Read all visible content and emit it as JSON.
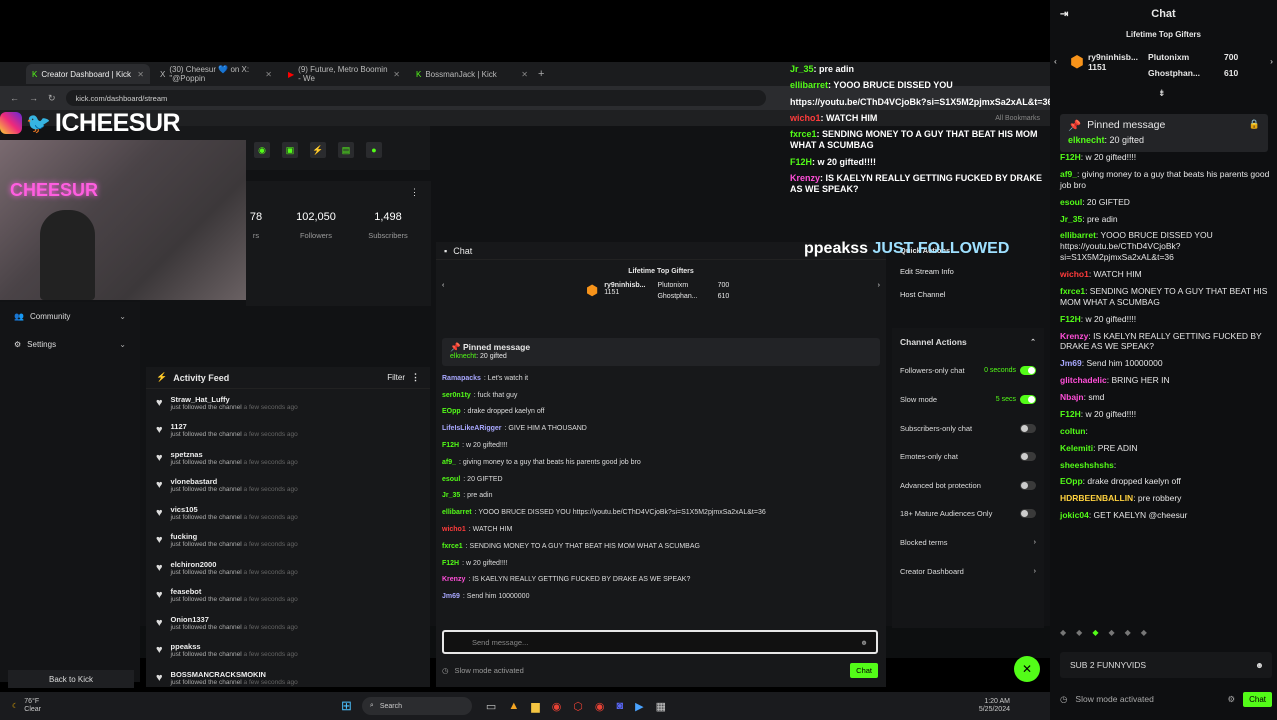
{
  "browser": {
    "tabs": [
      {
        "label": "Creator Dashboard | Kick",
        "active": true
      },
      {
        "label": "(30) Cheesur 💙 on X: \"@Poppin",
        "active": false
      },
      {
        "label": "(9) Future, Metro Boomin - We",
        "active": false
      },
      {
        "label": "BossmanJack | Kick",
        "active": false
      }
    ],
    "url": "kick.com/dashboard/stream",
    "all_bookmarks": "All Bookmarks"
  },
  "overlay": {
    "handle": "ICHEESUR",
    "followed_name": "ppeakss",
    "followed_text": "JUST FOLLOWED",
    "chat": [
      {
        "user": "Jr_35",
        "text": ": pre adin",
        "color": "#53fc18"
      },
      {
        "user": "ellibarret",
        "text": ": YOOO BRUCE DISSED YOU",
        "color": "#53fc18"
      },
      {
        "user": "",
        "text": "https://youtu.be/CThD4VCjoBk?si=S1X5M2pjmxSa2xAL&t=36",
        "color": "#fff"
      },
      {
        "user": "wicho1",
        "text": ": WATCH HIM",
        "color": "#ff3b3b"
      },
      {
        "user": "fxrce1",
        "text": ": SENDING MONEY TO A GUY THAT BEAT HIS MOM WHAT A SCUMBAG",
        "color": "#53fc18"
      },
      {
        "user": "F12H",
        "text": ": w 20 gifted!!!!",
        "color": "#53fc18"
      },
      {
        "user": "Krenzy",
        "text": ": IS KAELYN REALLY GETTING FUCKED BY DRAKE AS WE SPEAK?",
        "color": "#ff4fd8"
      }
    ]
  },
  "dashboard": {
    "stats": [
      {
        "value": "78",
        "label": "rs"
      },
      {
        "value": "102,050",
        "label": "Followers"
      },
      {
        "value": "1,498",
        "label": "Subscribers"
      }
    ],
    "nav": [
      {
        "label": "Community"
      },
      {
        "label": "Settings"
      }
    ],
    "back": "Back to Kick",
    "activity": {
      "title": "Activity Feed",
      "filter": "Filter",
      "sub": "just followed the channel",
      "time": "a few seconds ago",
      "items": [
        "Straw_Hat_Luffy",
        "1127",
        "spetznas",
        "vlonebastard",
        "vics105",
        "fucking",
        "elchiron2000",
        "feasebot",
        "Onion1337",
        "ppeakss",
        "BOSSMANCRACKSMOKIN"
      ]
    }
  },
  "mid_chat": {
    "title": "Chat",
    "gifters_title": "Lifetime Top Gifters",
    "gifters": [
      {
        "name": "ry9ninhisb...",
        "value": "1151"
      },
      {
        "name": "Plutonixm",
        "value": "700"
      },
      {
        "name": "Ghostphan...",
        "value": "610"
      }
    ],
    "pinned_title": "Pinned message",
    "pinned_user": "elknecht",
    "pinned_text": ": 20 gifted",
    "messages": [
      {
        "user": "Ramapacks",
        "text": ": Let's watch it",
        "color": "#a8a8ff"
      },
      {
        "user": "ser0n1ty",
        "text": ": fuck that guy",
        "color": "#53fc18"
      },
      {
        "user": "EOpp",
        "text": ": drake dropped kaelyn off",
        "color": "#53fc18"
      },
      {
        "user": "LifeIsLikeARigger",
        "text": ": GIVE HIM A THOUSAND",
        "color": "#a8a8ff"
      },
      {
        "user": "F12H",
        "text": ": w 20 gifted!!!!",
        "color": "#53fc18"
      },
      {
        "user": "af9_",
        "text": ": giving money to a guy that beats his parents good job bro",
        "color": "#53fc18"
      },
      {
        "user": "esoul",
        "text": ": 20 GIFTED",
        "color": "#53fc18"
      },
      {
        "user": "Jr_35",
        "text": ": pre adin",
        "color": "#53fc18"
      },
      {
        "user": "ellibarret",
        "text": ": YOOO BRUCE DISSED YOU https://youtu.be/CThD4VCjoBk?si=S1X5M2pjmxSa2xAL&t=36",
        "color": "#53fc18"
      },
      {
        "user": "wicho1",
        "text": ": WATCH HIM",
        "color": "#ff3b3b"
      },
      {
        "user": "fxrce1",
        "text": ": SENDING MONEY TO A GUY THAT BEAT HIS MOM WHAT A SCUMBAG",
        "color": "#53fc18"
      },
      {
        "user": "F12H",
        "text": ": w 20 gifted!!!!",
        "color": "#53fc18"
      },
      {
        "user": "Krenzy",
        "text": ": IS KAELYN REALLY GETTING FUCKED BY DRAKE AS WE SPEAK?",
        "color": "#ff4fd8"
      },
      {
        "user": "Jm69",
        "text": ": Send him 10000000",
        "color": "#a8a8ff"
      }
    ],
    "placeholder": "Send message...",
    "slow": "Slow mode activated",
    "chat_btn": "Chat"
  },
  "actions": {
    "quick": "Quick Actions",
    "edit": "Edit Stream Info",
    "host": "Host Channel",
    "title": "Channel Actions",
    "rows": [
      {
        "label": "Followers-only chat",
        "value": "0 seconds",
        "on": true
      },
      {
        "label": "Slow mode",
        "value": "5 secs",
        "on": true
      },
      {
        "label": "Subscribers-only chat",
        "value": "",
        "on": false
      },
      {
        "label": "Emotes-only chat",
        "value": "",
        "on": false
      },
      {
        "label": "Advanced bot protection",
        "value": "",
        "on": false
      },
      {
        "label": "18+ Mature Audiences Only",
        "value": "",
        "on": false
      },
      {
        "label": "Blocked terms",
        "value": "",
        "on": null
      },
      {
        "label": "Creator Dashboard",
        "value": "",
        "on": null
      }
    ]
  },
  "taskbar": {
    "temp": "76°F",
    "weather": "Clear",
    "search": "Search",
    "time": "1:20 AM",
    "date": "5/25/2024"
  },
  "rside": {
    "title": "Chat",
    "gifters_title": "Lifetime Top Gifters",
    "gifters": [
      {
        "name": "ry9ninhisb...",
        "value": "1151"
      },
      {
        "name": "Plutonixm",
        "value": "700"
      },
      {
        "name": "Ghostphan...",
        "value": "610"
      }
    ],
    "pinned_title": "Pinned message",
    "pinned_user": "elknecht",
    "pinned_text": ": 20 gifted",
    "messages": [
      {
        "user": "F12H",
        "text": ": w 20 gifted!!!!",
        "color": "#53fc18"
      },
      {
        "user": "af9_",
        "text": ": giving money to a guy that beats his parents good job bro",
        "color": "#53fc18"
      },
      {
        "user": "esoul",
        "text": ": 20 GIFTED",
        "color": "#53fc18"
      },
      {
        "user": "Jr_35",
        "text": ": pre adin",
        "color": "#53fc18"
      },
      {
        "user": "ellibarret",
        "text": ": YOOO BRUCE DISSED YOU https://youtu.be/CThD4VCjoBk?si=S1X5M2pjmxSa2xAL&t=36",
        "color": "#53fc18"
      },
      {
        "user": "wicho1",
        "text": ": WATCH HIM",
        "color": "#ff3b3b"
      },
      {
        "user": "fxrce1",
        "text": ": SENDING MONEY TO A GUY THAT BEAT HIS MOM WHAT A SCUMBAG",
        "color": "#53fc18"
      },
      {
        "user": "F12H",
        "text": ": w 20 gifted!!!!",
        "color": "#53fc18"
      },
      {
        "user": "Krenzy",
        "text": ": IS KAELYN REALLY GETTING FUCKED BY DRAKE AS WE SPEAK?",
        "color": "#ff4fd8"
      },
      {
        "user": "Jm69",
        "text": ": Send him 10000000",
        "color": "#a8a8ff"
      },
      {
        "user": "glitchadelic",
        "text": ": BRING HER IN",
        "color": "#ff4fd8"
      },
      {
        "user": "Nbajn",
        "text": ": smd",
        "color": "#ff4fd8"
      },
      {
        "user": "F12H",
        "text": ": w 20 gifted!!!!",
        "color": "#53fc18"
      },
      {
        "user": "coltun",
        "text": ":",
        "color": "#53fc18"
      },
      {
        "user": "Kelemiti",
        "text": ": PRE ADIN",
        "color": "#53fc18"
      },
      {
        "user": "sheeshshshs",
        "text": ":",
        "color": "#53fc18"
      },
      {
        "user": "EOpp",
        "text": ": drake dropped kaelyn off",
        "color": "#53fc18"
      },
      {
        "user": "HDRBEENBALLIN",
        "text": ": pre robbery",
        "color": "#ffd23f"
      },
      {
        "user": "jokic04",
        "text": ": GET KAELYN @cheesur",
        "color": "#53fc18"
      }
    ],
    "input": "SUB 2 FUNNYVIDS",
    "slow": "Slow mode activated",
    "chat_btn": "Chat"
  }
}
